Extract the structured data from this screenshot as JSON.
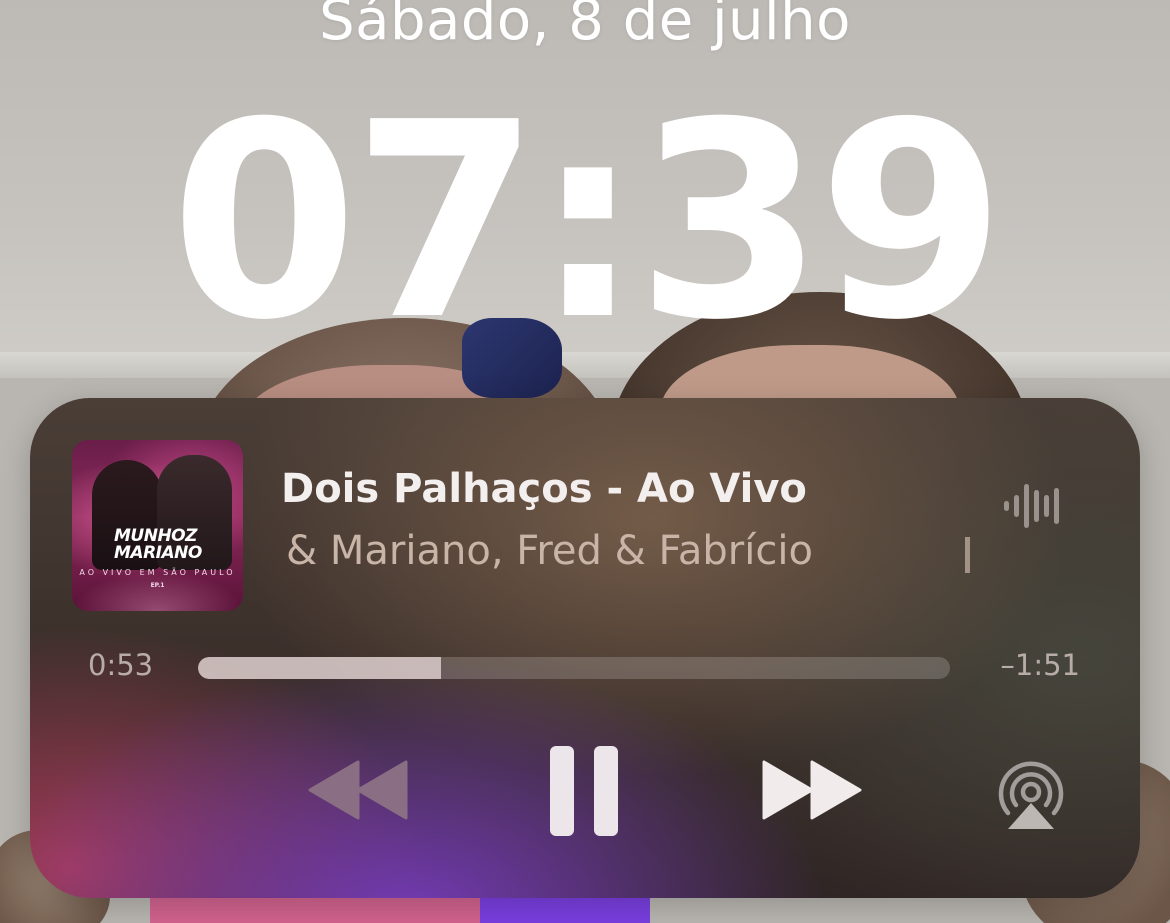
{
  "lockscreen": {
    "date": "Sábado, 8 de julho",
    "time": "07:39"
  },
  "now_playing": {
    "track_title": "Dois Palhaços - Ao Vivo",
    "artist": "& Mariano, Fred & Fabrício",
    "album_art": {
      "logo_line1": "MUNHOZ",
      "logo_line2": "MARIANO",
      "subtitle": "AO VIVO EM SÃO PAULO",
      "edition": "EP.1"
    },
    "elapsed": "0:53",
    "remaining": "–1:51",
    "progress_fraction": 0.323,
    "controls": {
      "rewind_icon": "backward-icon",
      "pause_icon": "pause-icon",
      "forward_icon": "forward-icon",
      "airplay_icon": "airplay-icon",
      "waveform_icon": "waveform-icon"
    }
  },
  "colors": {
    "text_primary": "#f3efee",
    "text_secondary": "#c9b4a8",
    "progress_fill": "#e8dad8"
  }
}
